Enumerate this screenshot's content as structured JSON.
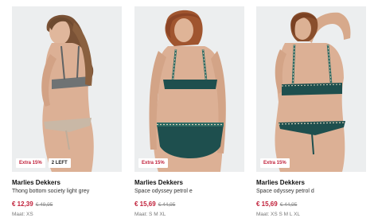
{
  "colors": {
    "accent": "#c0203a",
    "petrol": "#1e4f4e",
    "grey_lingerie": "#6f7374"
  },
  "products": [
    {
      "badges": [
        "Extra 15%",
        "2 LEFT"
      ],
      "brand": "Marlies Dekkers",
      "name": "Thong bottom society light grey",
      "price": "€ 12,39",
      "old_price": "€ 49,95",
      "sizes": "Maat: XS"
    },
    {
      "badges": [
        "Extra 15%"
      ],
      "brand": "Marlies Dekkers",
      "name": "Space odyssey petrol e",
      "price": "€ 15,69",
      "old_price": "€ 44,95",
      "sizes": "Maat: S M XL"
    },
    {
      "badges": [
        "Extra 15%"
      ],
      "brand": "Marlies Dekkers",
      "name": "Space odyssey petrol d",
      "price": "€ 15,69",
      "old_price": "€ 44,95",
      "sizes": "Maat: XS S M L XL"
    }
  ]
}
